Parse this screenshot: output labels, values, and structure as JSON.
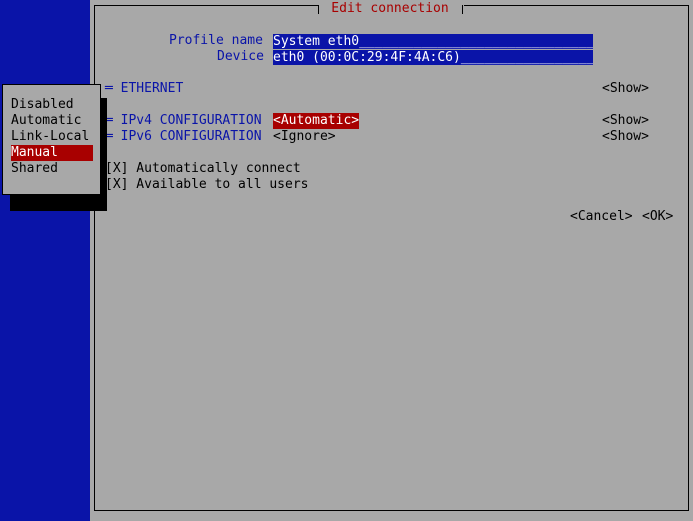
{
  "dialog": {
    "title": "Edit connection",
    "profile_name_label": "Profile name",
    "profile_name_value": "System eth0_______________________________",
    "device_label": "Device",
    "device_value": "eth0 (00:0C:29:4F:4A:C6)_________________",
    "ethernet_label": "═ ETHERNET",
    "ethernet_show": "<Show>",
    "ipv4_label": "═ IPv4 CONFIGURATION",
    "ipv4_value": "<Automatic>",
    "ipv4_show": "<Show>",
    "ipv6_label": "═ IPv6 CONFIGURATION",
    "ipv6_value": "<Ignore>",
    "ipv6_show": "<Show>",
    "auto_connect": "[X] Automatically connect",
    "all_users": "[X] Available to all users",
    "cancel": "<Cancel>",
    "ok": "<OK>"
  },
  "popup": {
    "items": [
      "Disabled",
      "Automatic",
      "Link-Local",
      "Manual",
      "Shared"
    ],
    "selected": "Manual"
  },
  "colors": {
    "background": "#0a14a8",
    "window": "#a8a8a8",
    "accent": "#a80000",
    "field": "#0a14a8"
  }
}
